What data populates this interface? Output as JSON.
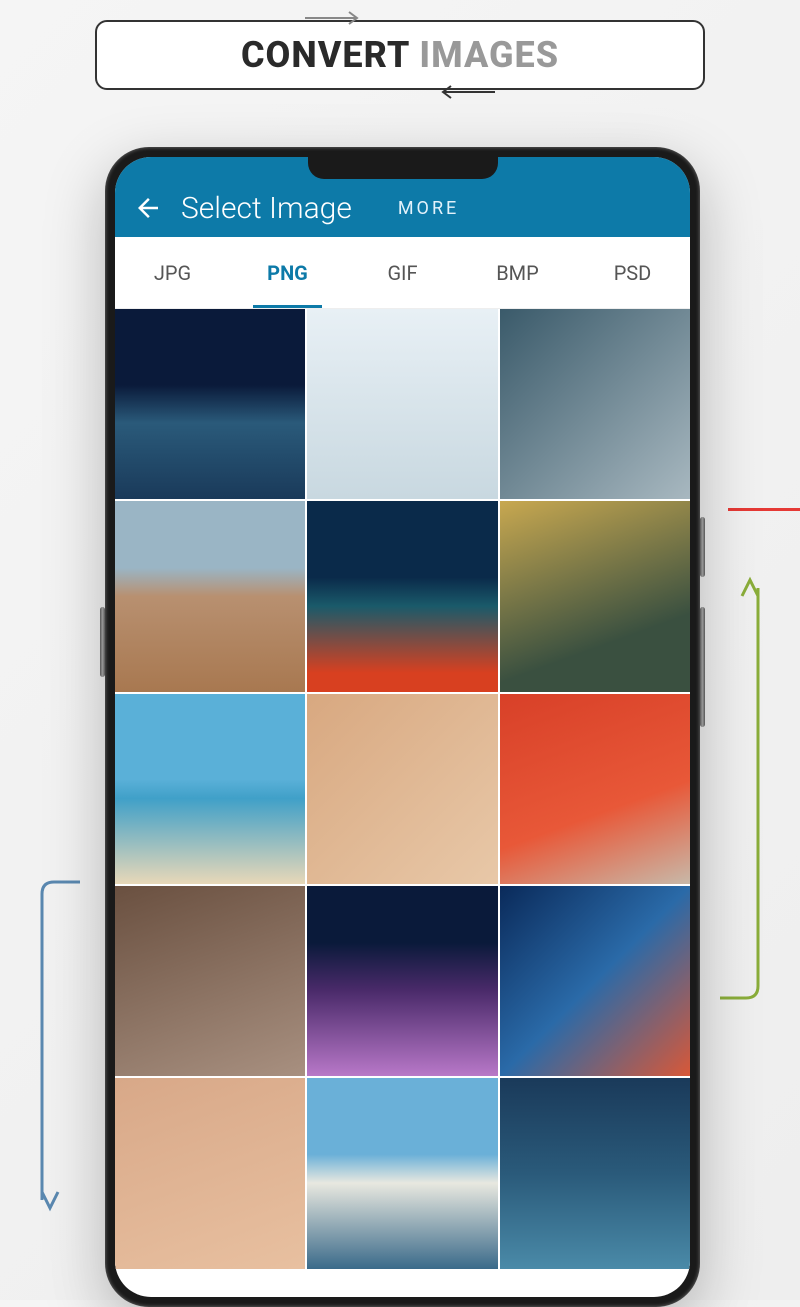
{
  "banner": {
    "word1": "CONVERT",
    "word2": "IMAGES"
  },
  "appbar": {
    "title": "Select Image",
    "more": "MORE"
  },
  "tabs": [
    {
      "label": "JPG",
      "active": false
    },
    {
      "label": "PNG",
      "active": true
    },
    {
      "label": "GIF",
      "active": false
    },
    {
      "label": "BMP",
      "active": false
    },
    {
      "label": "PSD",
      "active": false
    }
  ],
  "grid": {
    "count": 15
  }
}
